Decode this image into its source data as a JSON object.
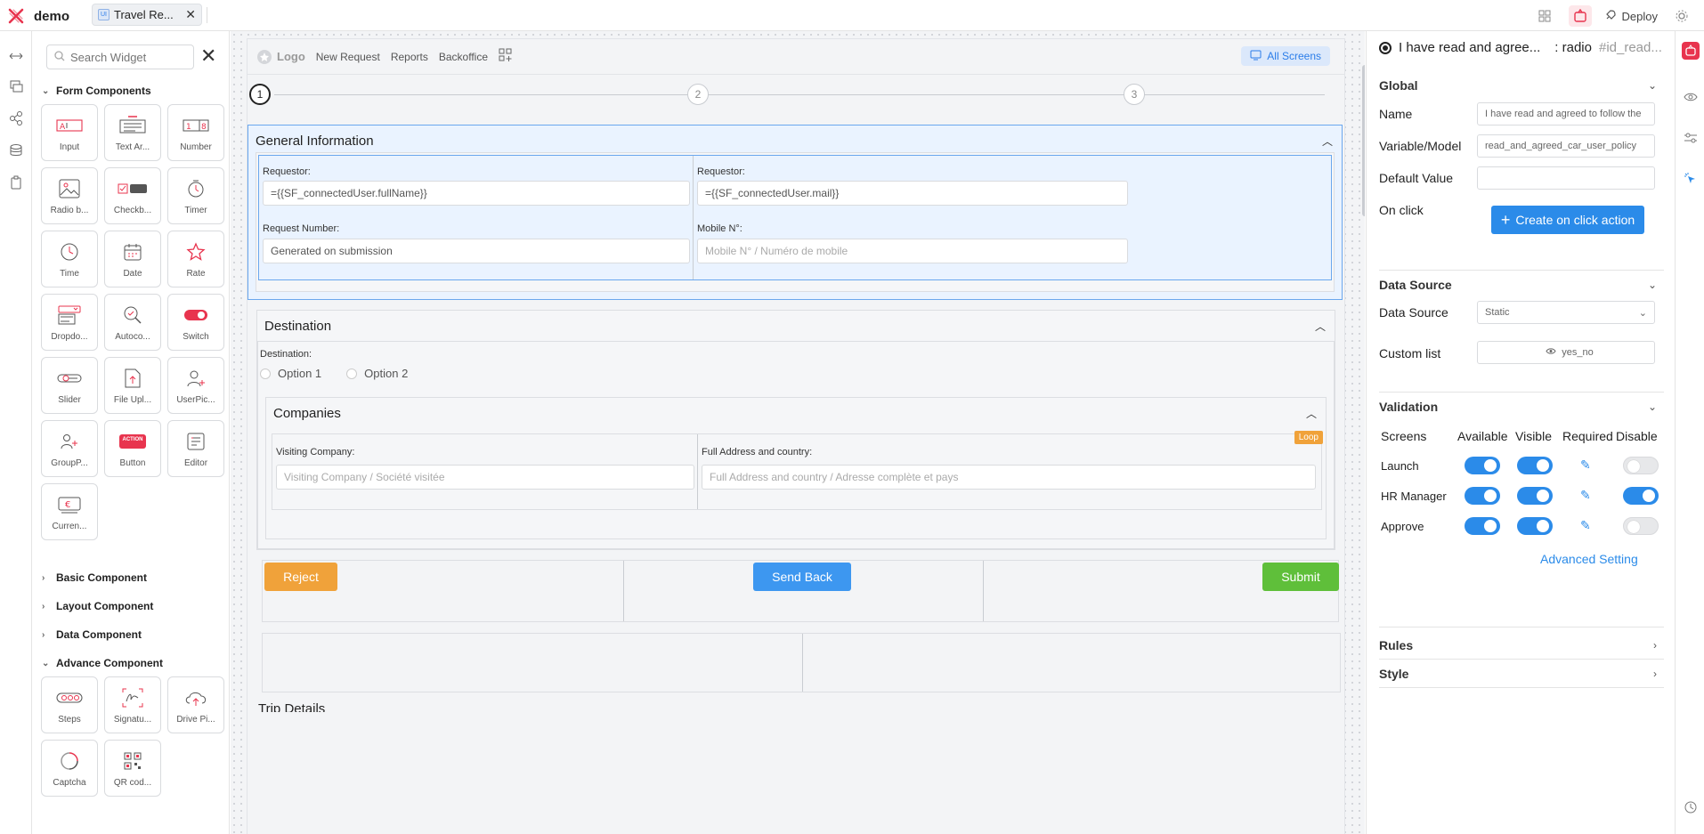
{
  "app": {
    "name": "demo",
    "tab_label": "Travel Re...",
    "deploy_label": "Deploy"
  },
  "palette": {
    "search_placeholder": "Search Widget",
    "sections": {
      "form": "Form Components",
      "basic": "Basic Component",
      "layout": "Layout Component",
      "data": "Data Component",
      "advance": "Advance Component"
    },
    "form_widgets": [
      "Input",
      "Text Ar...",
      "Number",
      "Radio b...",
      "Checkb...",
      "Timer",
      "Time",
      "Date",
      "Rate",
      "Dropdo...",
      "Autoco...",
      "Switch",
      "Slider",
      "File Upl...",
      "UserPic...",
      "GroupP...",
      "Button",
      "Editor",
      "Curren..."
    ],
    "advance_widgets": [
      "Steps",
      "Signatu...",
      "Drive Pi...",
      "Captcha",
      "QR cod..."
    ],
    "button_badge": "ACTION"
  },
  "canvas": {
    "nav": {
      "logo": "Logo",
      "links": [
        "New Request",
        "Reports",
        "Backoffice"
      ],
      "all_screens": "All Screens"
    },
    "steps": [
      "1",
      "2",
      "3"
    ],
    "general": {
      "title": "General Information",
      "requestor_label_1": "Requestor:",
      "requestor_value_1": "={{SF_connectedUser.fullName}}",
      "requestor_label_2": "Requestor:",
      "requestor_value_2": "={{SF_connectedUser.mail}}",
      "request_number_label": "Request Number:",
      "request_number_placeholder": "Generated on submission",
      "mobile_label": "Mobile N°:",
      "mobile_placeholder": "Mobile N° / Numéro de mobile"
    },
    "destination": {
      "title": "Destination",
      "field_label": "Destination:",
      "options": [
        "Option 1",
        "Option 2"
      ],
      "companies": {
        "title": "Companies",
        "loop_badge": "Loop",
        "visiting_label": "Visiting Company:",
        "visiting_placeholder": "Visiting Company /  Société visitée",
        "address_label": "Full Address and country:",
        "address_placeholder": "Full Address and country / Adresse complète et pays"
      }
    },
    "actions": {
      "reject": "Reject",
      "send_back": "Send Back",
      "submit": "Submit"
    },
    "bottom_peek": "Trip Details"
  },
  "properties": {
    "title": "I have read and agree...",
    "type": ": radio",
    "id": "#id_read...",
    "global": {
      "title": "Global",
      "name_label": "Name",
      "name_value": "I have read and agreed to follow the",
      "var_label": "Variable/Model",
      "var_value": "read_and_agreed_car_user_policy",
      "default_label": "Default Value",
      "default_value": "",
      "onclick_label": "On click",
      "onclick_button": "Create on click action"
    },
    "data_source": {
      "title": "Data Source",
      "ds_label": "Data Source",
      "ds_value": "Static",
      "custom_label": "Custom list",
      "custom_value": "yes_no"
    },
    "validation": {
      "title": "Validation",
      "headers": [
        "Screens",
        "Available",
        "Visible",
        "Required",
        "Disable"
      ],
      "rows": [
        {
          "screen": "Launch",
          "available": true,
          "visible": true,
          "disable": false
        },
        {
          "screen": "HR Manager",
          "available": true,
          "visible": true,
          "disable": true
        },
        {
          "screen": "Approve",
          "available": true,
          "visible": true,
          "disable": false
        }
      ],
      "advanced": "Advanced Setting"
    },
    "rules": "Rules",
    "style": "Style"
  },
  "colors": {
    "accent": "#2b8be9",
    "brand": "#e8344e",
    "reject": "#f0a23a",
    "submit": "#5fbf3a",
    "loop": "#f0a23a"
  }
}
